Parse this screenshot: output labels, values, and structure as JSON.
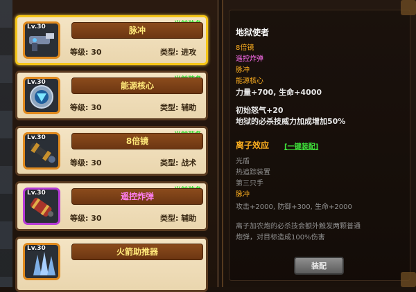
{
  "equipment_list": [
    {
      "name": "脉冲",
      "level_label": "Lv.30",
      "level_text": "等级: 30",
      "type_text": "类型: 进攻",
      "equipped": "当前装备",
      "icon": "pulse-gun-icon",
      "selected": true
    },
    {
      "name": "能源核心",
      "level_label": "Lv.30",
      "level_text": "等级: 30",
      "type_text": "类型: 辅助",
      "equipped": "当前装备",
      "icon": "energy-core-icon"
    },
    {
      "name": "8倍镜",
      "level_label": "Lv.30",
      "level_text": "等级: 30",
      "type_text": "类型: 战术",
      "equipped": "当前装备",
      "icon": "scope-icon"
    },
    {
      "name": "遥控炸弹",
      "level_label": "Lv.30",
      "level_text": "等级: 30",
      "type_text": "类型: 辅助",
      "equipped": "当前装备",
      "icon": "remote-bomb-icon"
    },
    {
      "name": "火箭助推器",
      "level_label": "Lv.30",
      "icon": "rocket-booster-icon"
    }
  ],
  "detail": {
    "title": "地狱使者",
    "parts": [
      "8倍镜",
      "遥控炸弹",
      "脉冲",
      "能源核心"
    ],
    "stats": "力量+700, 生命+4000",
    "rage": "初始怒气+20",
    "skill_boost": "地狱的必杀技威力加成增加50%",
    "ion_title": "离子效应",
    "one_key": "[一键装配]",
    "ion_parts": [
      "光盾",
      "热追踪装置",
      "第三只手",
      "脉冲"
    ],
    "ion_stats": "攻击+2000, 防御+300, 生命+2000",
    "ion_desc_1": "离子加农炮的必杀技会额外触发两颗普通",
    "ion_desc_2": "炮弹，对目标造成100%伤害"
  },
  "equip_button": "装配",
  "colors": {
    "equipped_green": "#3ee03a",
    "highlight_gold": "#f5c518",
    "orange_text": "#ffb020",
    "pink_text": "#ff6ef0"
  }
}
